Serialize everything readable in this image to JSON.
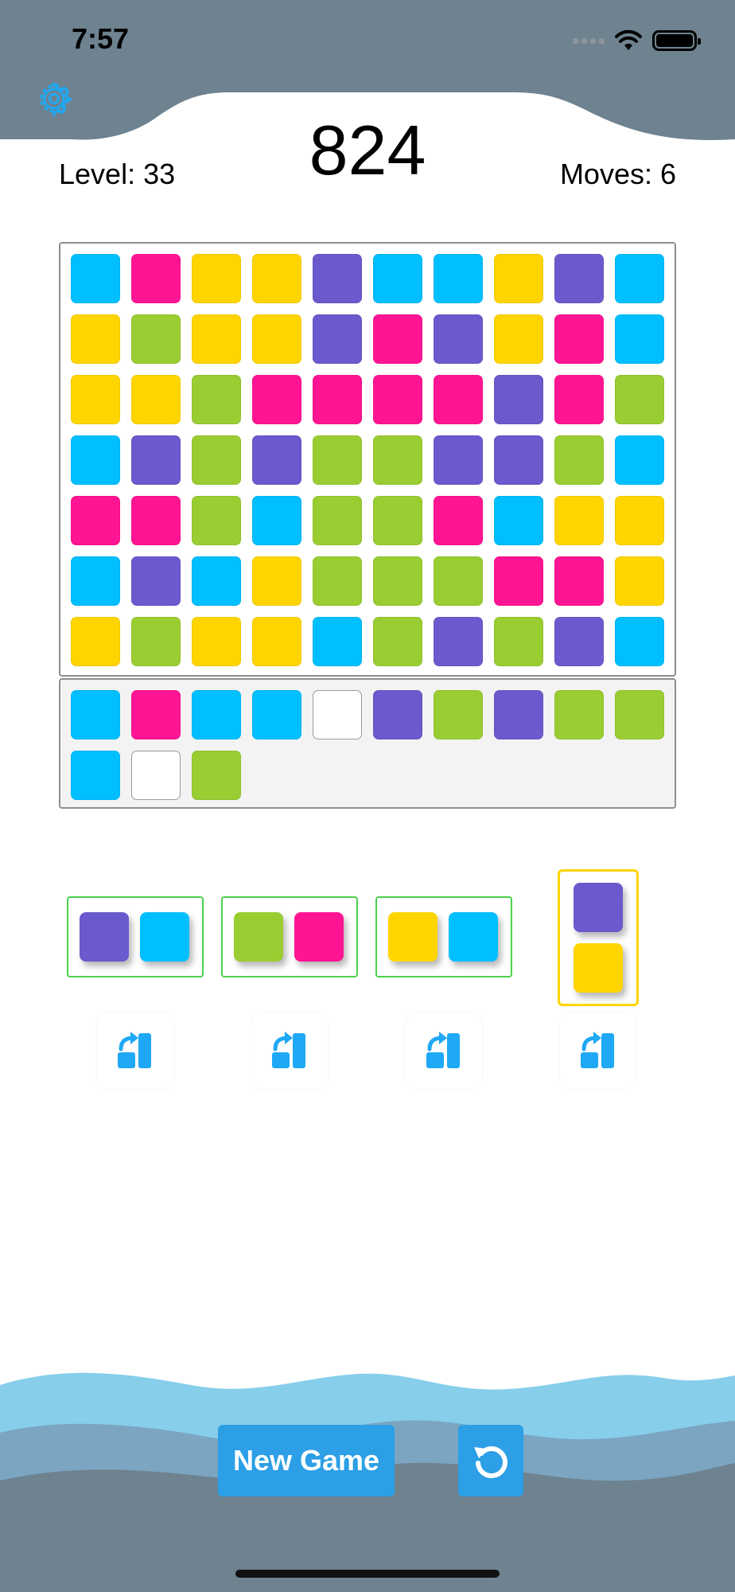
{
  "status_bar": {
    "time": "7:57"
  },
  "colors": {
    "cyan": "#00bfff",
    "pink": "#ff1493",
    "yellow": "#ffd500",
    "purple": "#6a5acd",
    "green": "#9acd32",
    "empty": "#ffffff",
    "header": "#6e8290",
    "wave_light": "#87ceeb",
    "wave_mid": "#7ba5c1",
    "button": "#2c9fe6"
  },
  "hud": {
    "score": "824",
    "level_label": "Level: 33",
    "moves_label": "Moves: 6"
  },
  "board": {
    "columns": 10,
    "rows": [
      [
        "cyan",
        "pink",
        "yellow",
        "yellow",
        "purple",
        "cyan",
        "cyan",
        "yellow",
        "purple",
        "cyan"
      ],
      [
        "yellow",
        "green",
        "yellow",
        "yellow",
        "purple",
        "pink",
        "purple",
        "yellow",
        "pink",
        "cyan"
      ],
      [
        "yellow",
        "yellow",
        "green",
        "pink",
        "pink",
        "pink",
        "pink",
        "purple",
        "pink",
        "green"
      ],
      [
        "cyan",
        "purple",
        "green",
        "purple",
        "green",
        "green",
        "purple",
        "purple",
        "green",
        "cyan"
      ],
      [
        "pink",
        "pink",
        "green",
        "cyan",
        "green",
        "green",
        "pink",
        "cyan",
        "yellow",
        "yellow"
      ],
      [
        "cyan",
        "purple",
        "cyan",
        "yellow",
        "green",
        "green",
        "green",
        "pink",
        "pink",
        "yellow"
      ],
      [
        "yellow",
        "green",
        "yellow",
        "yellow",
        "cyan",
        "green",
        "purple",
        "green",
        "purple",
        "cyan"
      ]
    ]
  },
  "queue": {
    "tiles": [
      "cyan",
      "pink",
      "cyan",
      "cyan",
      "empty",
      "purple",
      "green",
      "purple",
      "green",
      "green",
      "cyan",
      "empty",
      "green"
    ]
  },
  "pieces": [
    {
      "orientation": "horizontal",
      "tiles": [
        "purple",
        "cyan"
      ],
      "selected": false
    },
    {
      "orientation": "horizontal",
      "tiles": [
        "green",
        "pink"
      ],
      "selected": false
    },
    {
      "orientation": "horizontal",
      "tiles": [
        "yellow",
        "cyan"
      ],
      "selected": false
    },
    {
      "orientation": "vertical",
      "tiles": [
        "purple",
        "yellow"
      ],
      "selected": true
    }
  ],
  "icons": {
    "settings": "gear-icon",
    "rotate": "rotate-piece-icon",
    "reset": "restart-icon"
  },
  "footer": {
    "new_game_label": "New Game"
  }
}
